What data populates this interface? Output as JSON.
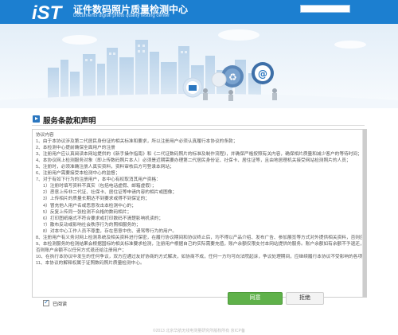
{
  "header": {
    "title": "证件数码照片质量检测中心",
    "subtitle": "Documents digital photo quality testing center",
    "search_placeholder": "",
    "top_links": ""
  },
  "colors": {
    "header_blue": "#1c7fd0",
    "accent_green": "#5fb14a",
    "section_icon": "#2b77c0"
  },
  "section": {
    "title": "服务条款和声明"
  },
  "terms": {
    "lines": [
      {
        "text": "协议内容",
        "indent": false
      },
      {
        "text": "1、由于本协议涉及第二代居民身份证的相关标准和要求，所以注册用户必须认真履行本协议的条款；",
        "indent": false
      },
      {
        "text": "2、本检测中心提前确保全面用户的注册",
        "indent": false
      },
      {
        "text": "3、注册用户应认真阅读本网站提供的《新手操作指南》和《二代证数码照片的标准及制作流程》，并确保严格按照有关内容，确保相片质量和减少客户的等待时间；",
        "indent": false
      },
      {
        "text": "4、本协议网上检测服务对象（即上传数码照片本人）必须是近期需要办理第二代居民身份证、社保卡、居住证等，且由地居理机关接受网站检测照片的人员；",
        "indent": false
      },
      {
        "text": "5、注册时，必须准确注册人真实资料，资料审核后方可登录本网站；",
        "indent": false
      },
      {
        "text": "6、注册用户需要接受本检测中心的监督；",
        "indent": false
      },
      {
        "text": "7、对于有如下行为的注册用户，本中心有权取消其用户资格：",
        "indent": false
      },
      {
        "text": "1）注册时填写资料不真实（包括电话虚假、邮箱虚假）；",
        "indent": true
      },
      {
        "text": "2）恶意上传非二代证、社保卡、居住证等申请内容的相片或图像；",
        "indent": true
      },
      {
        "text": "3）上传相片的质量长期达不到要求或得不到保证的；",
        "indent": true
      },
      {
        "text": "4）冒充他人用户名或恶意攻击本检测中心的；",
        "indent": true
      },
      {
        "text": "5）反复上传同一张检测不合格的数码相片；",
        "indent": true
      },
      {
        "text": "6）打印图纸格式不符合要求或打印数码不清楚影响机读的；",
        "indent": true
      },
      {
        "text": "7）散布反动或影响社会秩序行为的照相服务的；",
        "indent": true
      },
      {
        "text": "8）对本中心工作人员不尊重，存在恶意中伤、谩骂等行为的用户。",
        "indent": true
      },
      {
        "text": "8、注册用户有义务对网上检测系统及相关资料进行保密，在履行协议期间和协议终止后，均不得以产品介绍、发布广告、参加展览等方式对外提供相关资料，否则应承担因泄密行为而引起的法律后果；",
        "indent": false
      },
      {
        "text": "9、本检测服务的检测结果会根据国标的相关标准要求检测，注册用户根据自己的实际需要充值，账户余额仅限支付本网站提供的服务。账户余额如有余额不予退还，",
        "indent": false
      },
      {
        "text": "否则账户余额不以任何方式退还给注册用户；",
        "indent": false
      },
      {
        "text": "10、在执行本协议中发生的任何争议，双方应通过友好协商的方式解决，如协商不成，任何一方均可向法院起诉，争议处理期间，应继续履行本协议不受影响的各项条款；",
        "indent": false
      },
      {
        "text": "11、本协议的解释权属于证照数码照片质量检测中心。",
        "indent": false
      }
    ]
  },
  "agreement": {
    "checkbox_label": "已阅读",
    "checked": true
  },
  "buttons": {
    "agree": "同意",
    "reject": "拒绝"
  },
  "footer": {
    "text": "©2013 北京华航无线电测量研究所版权所有 京ICP备"
  }
}
